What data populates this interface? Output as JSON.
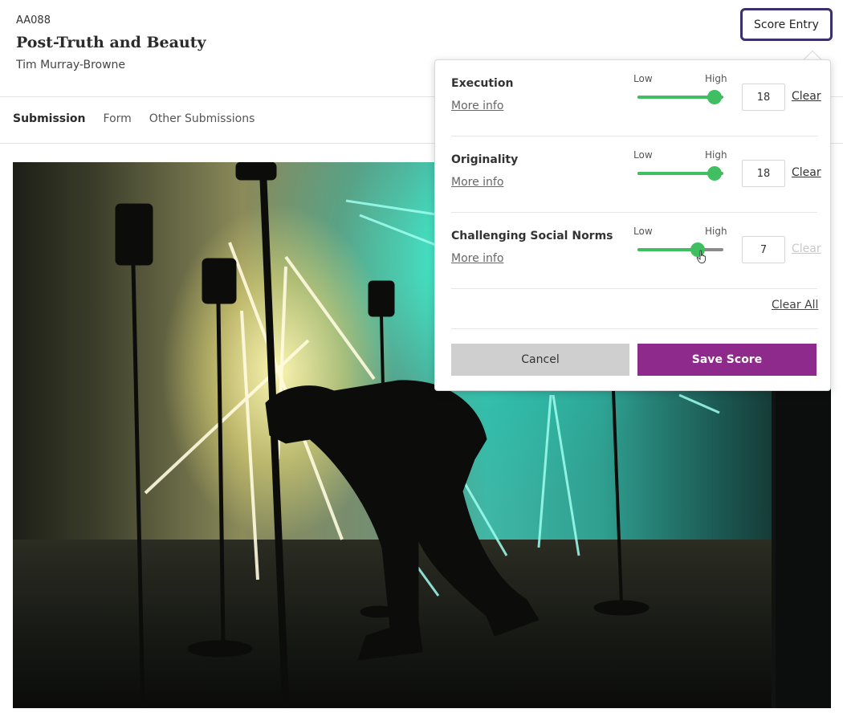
{
  "header": {
    "code": "AA088",
    "title": "Post-Truth and Beauty",
    "author": "Tim Murray-Browne",
    "score_entry_label": "Score Entry"
  },
  "tabs": [
    {
      "label": "Submission",
      "active": true
    },
    {
      "label": "Form",
      "active": false
    },
    {
      "label": "Other Submissions",
      "active": false
    }
  ],
  "photo": {
    "icon": "submission-photo"
  },
  "score_panel": {
    "slider_low_label": "Low",
    "slider_high_label": "High",
    "more_info_label": "More info",
    "clear_label": "Clear",
    "criteria": [
      {
        "name": "Execution",
        "value": "18",
        "level_fraction": 0.9,
        "clear_enabled": true
      },
      {
        "name": "Originality",
        "value": "18",
        "level_fraction": 0.9,
        "clear_enabled": true
      },
      {
        "name": "Challenging Social Norms",
        "value": "7",
        "level_fraction": 0.7,
        "clear_enabled": false
      }
    ],
    "clear_all_label": "Clear All",
    "cancel_label": "Cancel",
    "save_label": "Save Score"
  },
  "colors": {
    "accent_purple": "#8e2a8c",
    "score_entry_border": "#3c2f6e",
    "slider_green": "#3fbf62",
    "cancel_grey": "#cfcfcf"
  }
}
